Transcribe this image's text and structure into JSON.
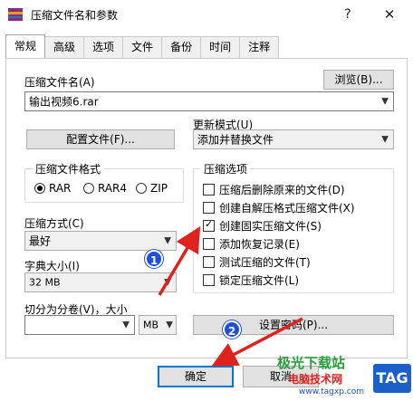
{
  "window": {
    "title": "压缩文件名和参数",
    "help": "?",
    "close": "✕"
  },
  "tabs": [
    "常规",
    "高级",
    "选项",
    "文件",
    "备份",
    "时间",
    "注释"
  ],
  "archive_name": {
    "label": "压缩文件名(A)",
    "value": "输出视频6.rar",
    "browse": "浏览(B)..."
  },
  "update_mode": {
    "label": "更新模式(U)",
    "value": "添加并替换文件"
  },
  "profile_button": "配置文件(F)...",
  "format": {
    "title": "压缩文件格式",
    "options": [
      "RAR",
      "RAR4",
      "ZIP"
    ],
    "selected": "RAR"
  },
  "options": {
    "title": "压缩选项",
    "items": [
      {
        "label": "压缩后删除原来的文件(D)",
        "checked": false
      },
      {
        "label": "创建自解压格式压缩文件(X)",
        "checked": false
      },
      {
        "label": "创建固实压缩文件(S)",
        "checked": true
      },
      {
        "label": "添加恢复记录(E)",
        "checked": false
      },
      {
        "label": "测试压缩的文件(T)",
        "checked": false
      },
      {
        "label": "锁定压缩文件(L)",
        "checked": false
      }
    ]
  },
  "method": {
    "label": "压缩方式(C)",
    "value": "最好"
  },
  "dictionary": {
    "label": "字典大小(I)",
    "value": "32 MB"
  },
  "split": {
    "label": "切分为分卷(V)，大小",
    "value": "",
    "unit": "MB"
  },
  "password_button": "设置密码(P)...",
  "ok_button": "确定",
  "cancel_button": "取消",
  "badges": [
    "1",
    "2"
  ],
  "watermark": {
    "line1": "极光下载站",
    "line2": "电脑技术网",
    "url": "www.tagxp.com",
    "tag": "TAG"
  },
  "colors": {
    "annotation_arrow": "#e0221e",
    "badge": "#1d4fd8"
  }
}
